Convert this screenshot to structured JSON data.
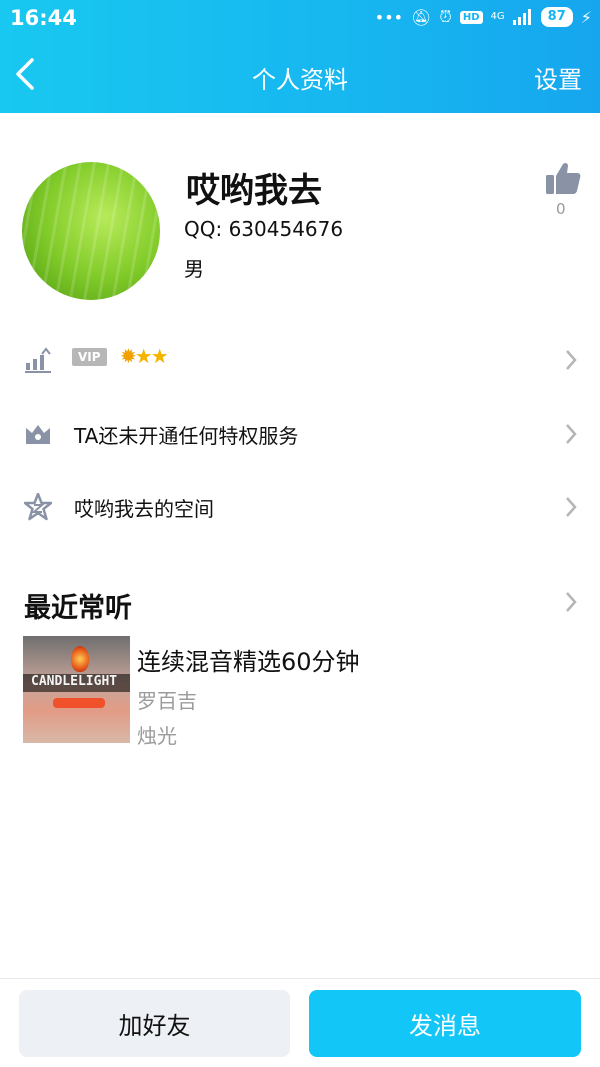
{
  "status_bar": {
    "time": "16:44",
    "network": "4G",
    "battery": "87",
    "hd": "HD"
  },
  "nav": {
    "title": "个人资料",
    "settings_label": "设置"
  },
  "profile": {
    "nickname": "哎哟我去",
    "qq_label": "QQ: 630454676",
    "gender": "男",
    "like_count": "0"
  },
  "rows": {
    "level": {
      "vip_badge": "VIP",
      "stars": "★★"
    },
    "privilege": {
      "label": "TA还未开通任何特权服务"
    },
    "space": {
      "label": "哎哟我去的空间"
    }
  },
  "recent": {
    "title": "最近常听",
    "song": {
      "title": "连续混音精选60分钟",
      "artist": "罗百吉",
      "album": "烛光",
      "cover_text": "CANDLELIGHT"
    }
  },
  "actions": {
    "add_friend": "加好友",
    "send_message": "发消息"
  },
  "colors": {
    "header_accent": "#18b6f0",
    "primary_button": "#13c6f8",
    "secondary_button": "#edf0f5"
  }
}
